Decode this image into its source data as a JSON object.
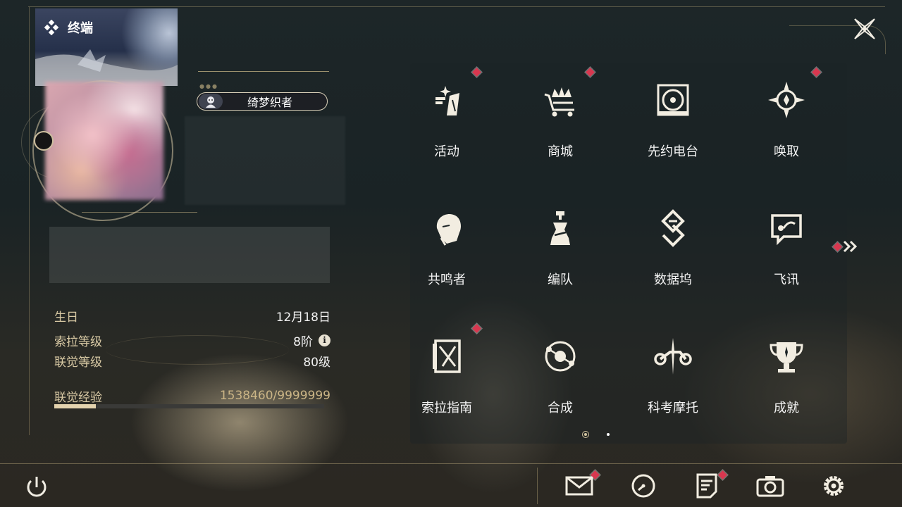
{
  "header": {
    "title": "终端"
  },
  "profile": {
    "title_badge": "绮梦织者",
    "stats": [
      {
        "label": "生日",
        "value": "12月18日"
      },
      {
        "label": "索拉等级",
        "value": "8阶"
      },
      {
        "label": "联觉等级",
        "value": "80级"
      }
    ],
    "exp": {
      "label": "联觉经验",
      "value": "1538460/9999999",
      "progress": 0.1538
    }
  },
  "menu": [
    {
      "label": "活动",
      "icon": "activity-icon",
      "badge": true
    },
    {
      "label": "商城",
      "icon": "shop-cart-icon",
      "badge": true
    },
    {
      "label": "先约电台",
      "icon": "radio-station-icon",
      "badge": false
    },
    {
      "label": "唤取",
      "icon": "compass-star-icon",
      "badge": true
    },
    {
      "label": "共鸣者",
      "icon": "resonator-head-icon",
      "badge": false
    },
    {
      "label": "编队",
      "icon": "chess-piece-icon",
      "badge": false
    },
    {
      "label": "数据坞",
      "icon": "data-dock-icon",
      "badge": false
    },
    {
      "label": "飞讯",
      "icon": "chat-message-icon",
      "badge": false
    },
    {
      "label": "索拉指南",
      "icon": "guide-book-icon",
      "badge": true
    },
    {
      "label": "合成",
      "icon": "synthesis-orbit-icon",
      "badge": false
    },
    {
      "label": "科考摩托",
      "icon": "motorbike-icon",
      "badge": false
    },
    {
      "label": "成就",
      "icon": "trophy-icon",
      "badge": false
    }
  ],
  "pager": {
    "current": 1,
    "total": 2
  },
  "bottom_bar": {
    "items": [
      {
        "name": "mail",
        "icon": "mail-icon",
        "badge": true
      },
      {
        "name": "clock",
        "icon": "clock-icon",
        "badge": false
      },
      {
        "name": "notice",
        "icon": "notice-board-icon",
        "badge": true
      },
      {
        "name": "camera",
        "icon": "camera-icon",
        "badge": false
      },
      {
        "name": "settings",
        "icon": "gear-icon",
        "badge": false
      }
    ]
  },
  "colors": {
    "accent": "#d2c49f",
    "badge_red": "#d8374f",
    "exp_fill": "#e4d3ae"
  }
}
